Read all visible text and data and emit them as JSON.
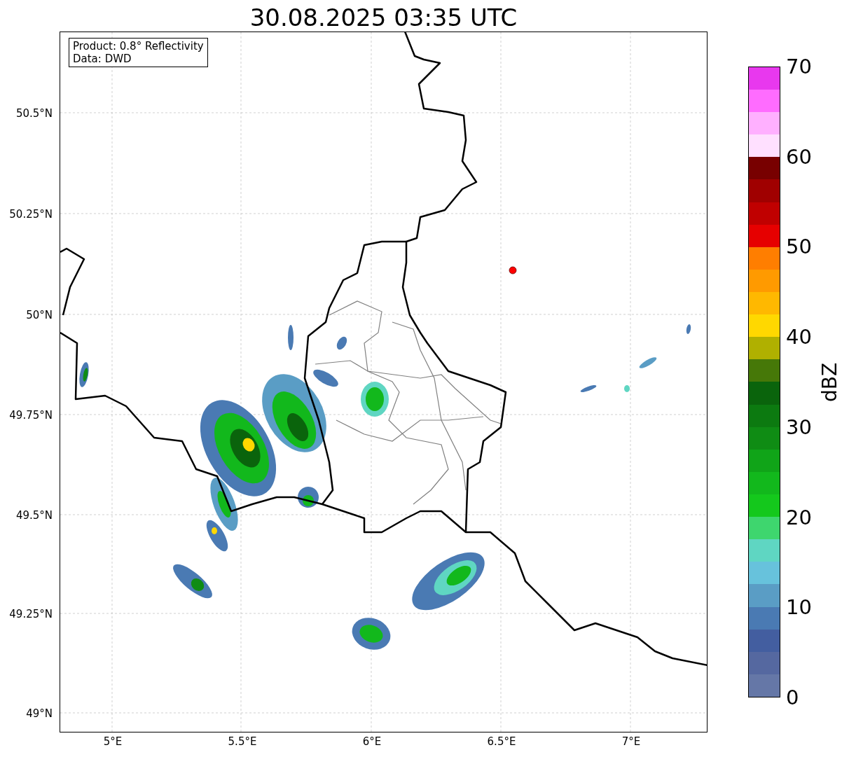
{
  "title": "30.08.2025 03:35 UTC",
  "legend": [
    "Product: 0.8° Reflectivity",
    "Data: DWD"
  ],
  "y_ticks": [
    "50.5°N",
    "50.25°N",
    "50°N",
    "49.75°N",
    "49.5°N",
    "49.25°N",
    "49°N"
  ],
  "x_ticks": [
    "5°E",
    "5.5°E",
    "6°E",
    "6.5°E",
    "7°E"
  ],
  "colorbar": {
    "label": "dBZ",
    "ticks": [
      "70",
      "60",
      "50",
      "40",
      "30",
      "20",
      "10",
      "0"
    ]
  }
}
